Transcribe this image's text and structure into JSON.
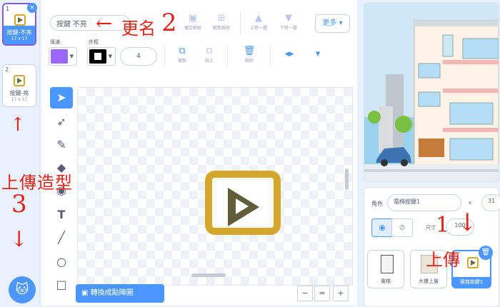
{
  "costumes": [
    {
      "num": "1",
      "name": "按鍵-不亮",
      "size": "17 x 17",
      "selected": true
    },
    {
      "num": "2",
      "name": "按鍵-亮",
      "size": "17 x 17",
      "selected": false
    }
  ],
  "toolbar": {
    "name_value": "按鍵 不亮",
    "group": "複合群組",
    "ungroup": "解散群組",
    "forward": "上移一層",
    "backward": "下移一層",
    "more": "更多",
    "fill_label": "填滿",
    "outline_label": "外框",
    "outline_width": "4",
    "copy": "複製",
    "paste": "貼上",
    "delete": "刪除"
  },
  "canvas": {
    "convert_label": "轉換成點陣圖"
  },
  "zoom": {
    "out": "−",
    "reset": "=",
    "in": "+"
  },
  "sprite": {
    "label": "角色",
    "name": "電梯按鍵1",
    "x_label": "x",
    "x_value": "31",
    "size_label": "尺寸",
    "size_value": "100",
    "cards": [
      {
        "name": "電梯",
        "selected": false
      },
      {
        "name": "大樓上層",
        "selected": false
      },
      {
        "name": "電梯按鍵1",
        "selected": true
      }
    ]
  },
  "annotations": {
    "rename": "更名",
    "rename_num": "2",
    "upload_costume": "上傳造型",
    "upload_num": "3",
    "upload": "上傳",
    "upload_step": "1"
  },
  "colors": {
    "accent": "#4c97ff",
    "fill": "#9966ff",
    "outline": "#000000",
    "annotation": "#e2231a"
  }
}
